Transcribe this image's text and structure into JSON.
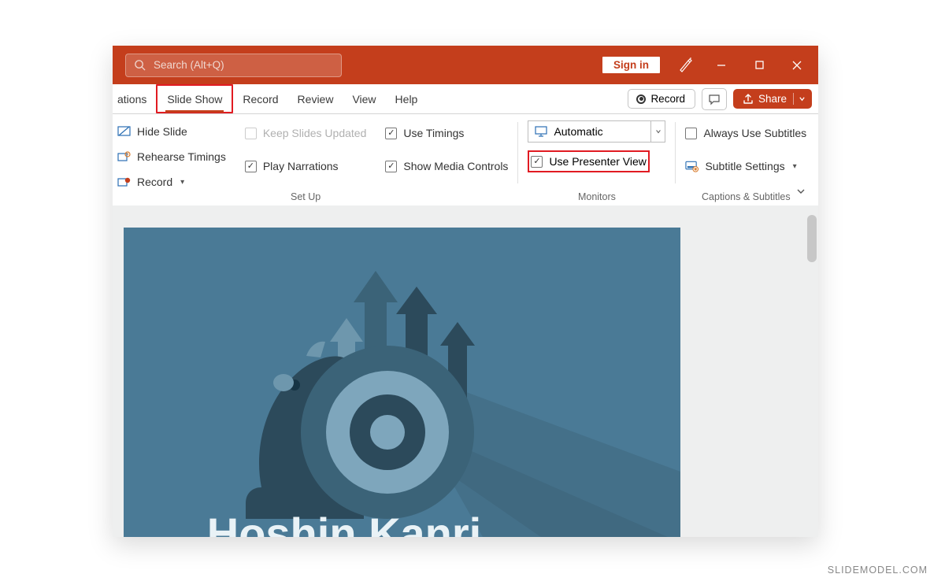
{
  "titlebar": {
    "search_placeholder": "Search (Alt+Q)",
    "signin": "Sign in"
  },
  "tabs": {
    "partial_left": "ations",
    "slide_show": "Slide Show",
    "record": "Record",
    "review": "Review",
    "view": "View",
    "help": "Help",
    "record_btn": "Record",
    "share": "Share"
  },
  "ribbon": {
    "hide_slide": "Hide Slide",
    "rehearse_timings": "Rehearse Timings",
    "record_dd": "Record",
    "keep_slides_updated": "Keep Slides Updated",
    "play_narrations": "Play Narrations",
    "use_timings": "Use Timings",
    "show_media_controls": "Show Media Controls",
    "setup_label": "Set Up",
    "monitor_value": "Automatic",
    "use_presenter_view": "Use Presenter View",
    "monitors_label": "Monitors",
    "always_use_subtitles": "Always Use Subtitles",
    "subtitle_settings": "Subtitle Settings",
    "captions_label": "Captions & Subtitles"
  },
  "slide": {
    "partial_title": "Hoshin Kanri"
  },
  "watermark": "SLIDEMODEL.COM"
}
